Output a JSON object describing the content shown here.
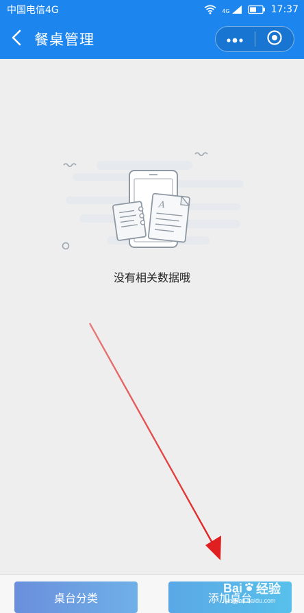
{
  "status_bar": {
    "carrier": "中国电信4G",
    "network": "4G",
    "time": "17:37"
  },
  "nav": {
    "title": "餐桌管理"
  },
  "empty_state": {
    "message": "没有相关数据哦"
  },
  "bottom": {
    "category_label": "桌台分类",
    "add_label": "添加桌台"
  },
  "watermark": {
    "brand": "Bai",
    "brand_cn": "经验",
    "url": "jingyan.baidu.com"
  },
  "colors": {
    "header": "#1c86ee",
    "background": "#eeeeee",
    "arrow": "#e02020"
  }
}
